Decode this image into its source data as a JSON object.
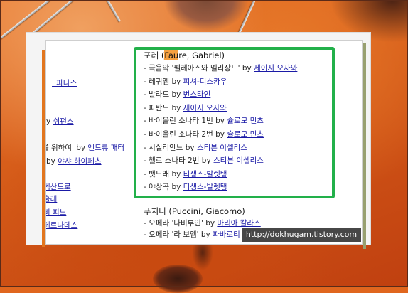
{
  "left_column": [
    {
      "text": "l 파나스",
      "link": true
    },
    {
      "text": "",
      "link": false
    },
    {
      "text": "",
      "link": false
    },
    {
      "text": "",
      "link": false
    },
    {
      "text": "",
      "link": false
    },
    {
      "prefix": "y ",
      "text": "쉬펀스",
      "link": true
    },
    {
      "text": "",
      "link": false
    },
    {
      "prefix": "를 위하여' by ",
      "text": "앤드류 패터",
      "link": true
    },
    {
      "prefix": "by ",
      "text": "야샤 하이페츠",
      "link": true
    },
    {
      "text": "",
      "link": false
    },
    {
      "text": "렉산드로",
      "link": true
    },
    {
      "text": "훌레",
      "link": true
    },
    {
      "text": "비 피노",
      "link": true
    },
    {
      "text": "페르나데스",
      "link": true
    }
  ],
  "faure": {
    "heading_pre": "포레 (",
    "heading_hl": "Fau",
    "heading_post": "re, Gabriel)",
    "items": [
      {
        "title": "- 극음악 '펠레아스와 멜리장드' by ",
        "performer": "세이지 오자와"
      },
      {
        "title": "- 레퀴엠 by ",
        "performer": "피셔-디스카우"
      },
      {
        "title": "- 발라드 by ",
        "performer": "번스타인"
      },
      {
        "title": "- 파반느 by ",
        "performer": "세이지 오자와"
      },
      {
        "title": "- 바이올린 소나타 1번 by ",
        "performer": "슐로모 민츠"
      },
      {
        "title": "- 바이올린 소나타 2번 by ",
        "performer": "슐로모 민츠"
      },
      {
        "title": "- 시실리안느 by ",
        "performer": "스티븐 이셀리스"
      },
      {
        "title": "- 첼로 소나타 2번 by ",
        "performer": "스티븐 이셀리스"
      },
      {
        "title": "- 뱃노래 by ",
        "performer": "티생스-발렛탱"
      },
      {
        "title": "- 야상곡 by ",
        "performer": "티생스-발렛탱"
      }
    ]
  },
  "puccini": {
    "heading": "푸치니 (Puccini, Giacomo)",
    "items": [
      {
        "title": "- 오페라 '나비부인' by ",
        "performer": "마리아 칼라스"
      },
      {
        "title": "- 오페라 '라 보엠' by ",
        "performer": "파바로티"
      }
    ]
  },
  "watermark": "http://dokhugam.tistory.com",
  "colors": {
    "highlight_border": "#22b04a",
    "link": "#1a1aa6",
    "text_highlight": "#f4a040"
  }
}
